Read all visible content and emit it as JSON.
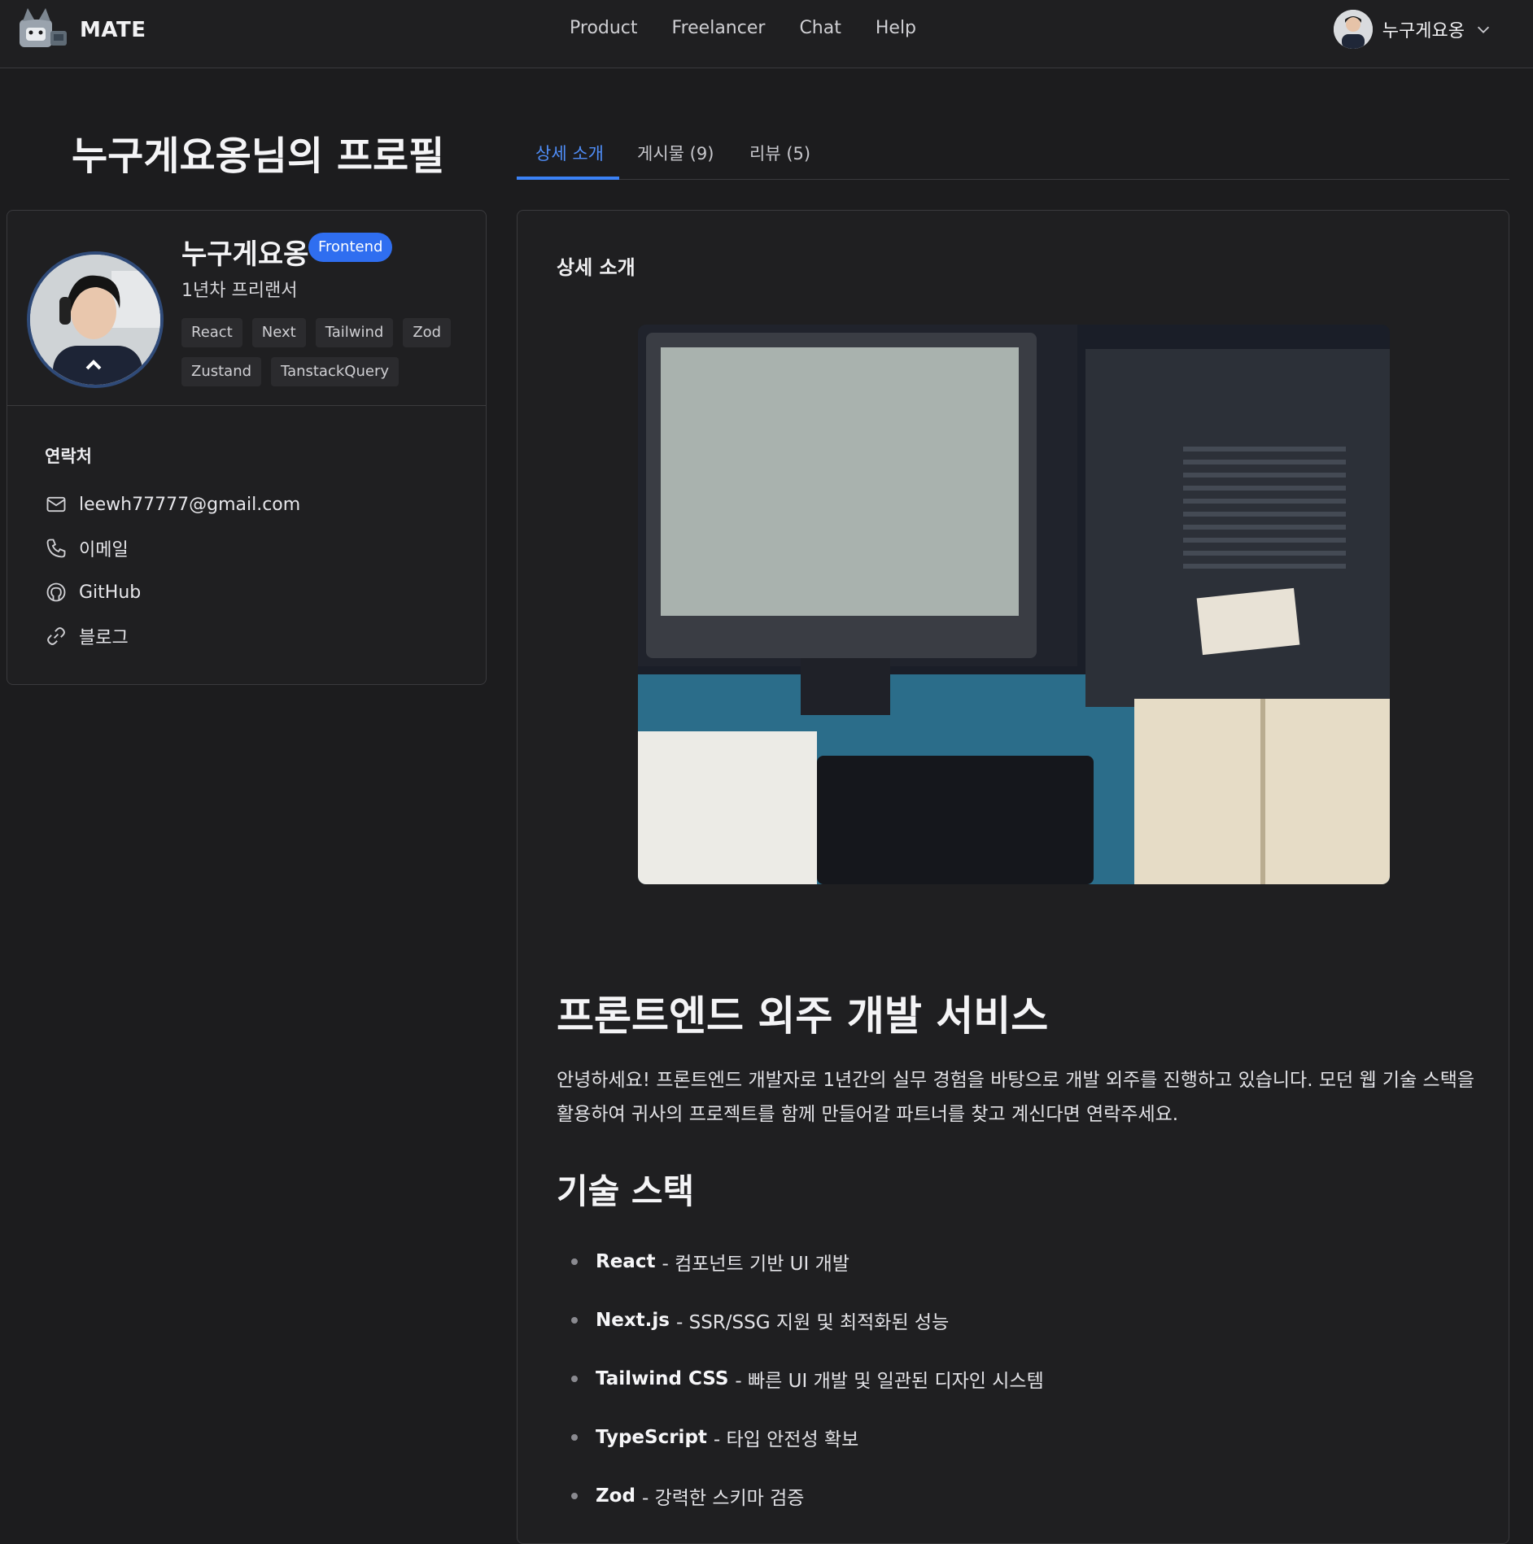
{
  "header": {
    "brand": "MATE",
    "nav": [
      "Product",
      "Freelancer",
      "Chat",
      "Help"
    ],
    "user_name": "누구게요옹"
  },
  "page": {
    "title": "누구게요옹님의 프로필",
    "tabs": [
      "상세 소개",
      "게시물 (9)",
      "리뷰 (5)"
    ],
    "active_tab": "상세 소개"
  },
  "profile": {
    "name": "누구게요옹",
    "role_badge": "Frontend",
    "experience": "1년차 프리랜서",
    "skills": [
      "React",
      "Next",
      "Tailwind",
      "Zod",
      "Zustand",
      "TanstackQuery"
    ],
    "contact_title": "연락처",
    "contacts": [
      {
        "icon": "mail-icon",
        "text": "leewh77777@gmail.com"
      },
      {
        "icon": "phone-icon",
        "text": "이메일"
      },
      {
        "icon": "github-icon",
        "text": "GitHub"
      },
      {
        "icon": "link-icon",
        "text": "블로그"
      }
    ]
  },
  "content": {
    "section_label": "상세 소개",
    "heading": "프론트엔드 외주 개발 서비스",
    "intro": "안녕하세요! 프론트엔드 개발자로 1년간의 실무 경험을 바탕으로 개발 외주를 진행하고 있습니다. 모던 웹 기술 스택을 활용하여 귀사의 프로젝트를 함께 만들어갈 파트너를 찾고 계신다면 연락주세요.",
    "stack_heading": "기술 스택",
    "stack": [
      {
        "name": "React",
        "desc": "- 컴포넌트 기반 UI 개발"
      },
      {
        "name": "Next.js",
        "desc": "- SSR/SSG 지원 및 최적화된 성능"
      },
      {
        "name": "Tailwind CSS",
        "desc": "- 빠른 UI 개발 및 일관된 디자인 시스템"
      },
      {
        "name": "TypeScript",
        "desc": "- 타입 안전성 확보"
      },
      {
        "name": "Zod",
        "desc": "- 강력한 스키마 검증"
      }
    ]
  },
  "colors": {
    "background": "#1c1c1e",
    "accent": "#3b82f6",
    "badge": "#2f6ef0"
  }
}
